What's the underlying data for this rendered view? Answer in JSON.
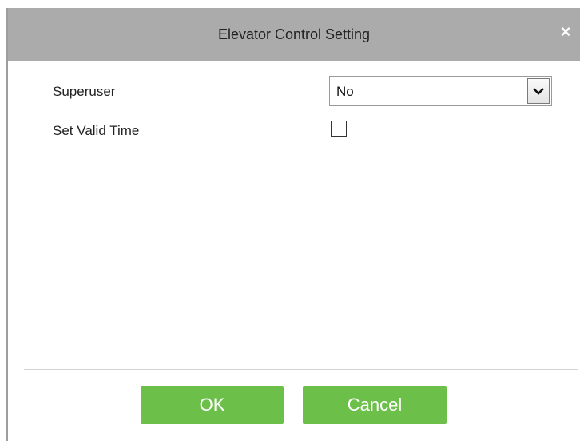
{
  "dialog": {
    "title": "Elevator Control Setting",
    "close_label": "×"
  },
  "form": {
    "superuser_label": "Superuser",
    "superuser_value": "No",
    "valid_time_label": "Set Valid Time",
    "valid_time_checked": false
  },
  "buttons": {
    "ok_label": "OK",
    "cancel_label": "Cancel"
  },
  "colors": {
    "titlebar": "#ababab",
    "button": "#6cc04a"
  },
  "icons": {
    "close": "close-icon",
    "dropdown": "chevron-down-icon",
    "checkbox": "checkbox-unchecked"
  }
}
